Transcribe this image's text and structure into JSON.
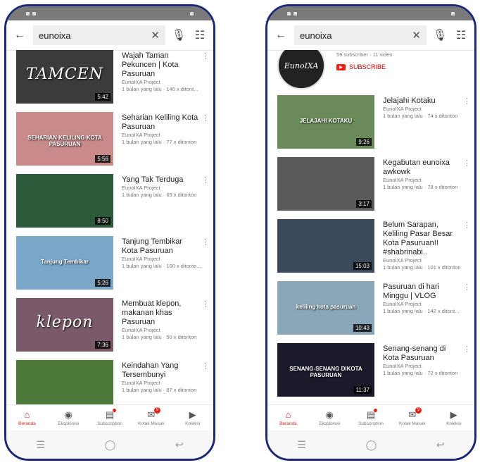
{
  "left": {
    "search": {
      "query": "eunoixa"
    },
    "videos": [
      {
        "title": "Wajah Taman Pekuncen | Kota Pasuruan",
        "channel": "EunoIXA Project",
        "stats": "1 bulan yang lalu · 140 x ditont...",
        "duration": "5:42",
        "caption": "TAMCEN"
      },
      {
        "title": "Seharian Keliling Kota Pasuruan",
        "channel": "EunoIXA Project",
        "stats": "1 bulan yang lalu · 77 x ditonton",
        "duration": "5:56",
        "caption": "SEHARIAN KELILING KOTA PASURUAN"
      },
      {
        "title": "Yang Tak Terduga",
        "channel": "EunoIXA Project",
        "stats": "1 bulan yang lalu · 65 x ditonton",
        "duration": "8:50",
        "caption": ""
      },
      {
        "title": "Tanjung Tembikar Kota Pasuruan",
        "channel": "EunoIXA Project",
        "stats": "1 bulan yang lalu · 100 x ditonto...",
        "duration": "5:26",
        "caption": "Tanjung Tembikar"
      },
      {
        "title": "Membuat klepon, makanan khas Pasuruan",
        "channel": "EunoIXA Project",
        "stats": "1 bulan yang lalu · 50 x ditonton",
        "duration": "7:36",
        "caption": "klepon"
      },
      {
        "title": "Keindahan Yang Tersembunyi",
        "channel": "EunoIXA Project",
        "stats": "1 bulan yang lalu · 87 x ditonton",
        "duration": "",
        "caption": ""
      }
    ]
  },
  "right": {
    "search": {
      "query": "eunoixa"
    },
    "channel": {
      "avatar_text": "EunoIXA",
      "subs": "59 subscriber · 11 video",
      "subscribe_label": "SUBSCRIBE"
    },
    "videos": [
      {
        "title": "Jelajahi Kotaku",
        "channel": "EunoIXA Project",
        "stats": "1 bulan yang lalu · 74 x ditonton",
        "duration": "9:26",
        "caption": "JELAJAHI KOTAKU"
      },
      {
        "title": "Kegabutan eunoixa awkowk",
        "channel": "EunoIXA Project",
        "stats": "1 bulan yang lalu · 78 x ditonton",
        "duration": "3:17",
        "caption": ""
      },
      {
        "title": "Belum Sarapan, Keliling Pasar Besar Kota Pasuruan!! #shabrinabi..",
        "channel": "EunoIXA Project",
        "stats": "1 bulan yang lalu · 101 x ditonton",
        "duration": "15:03",
        "caption": ""
      },
      {
        "title": "Pasuruan di hari Minggu | VLOG",
        "channel": "EunoIXA Project",
        "stats": "1 bulan yang lalu · 142 x ditont...",
        "duration": "10:43",
        "caption": "keliling kota pasuruan"
      },
      {
        "title": "Senang-senang di Kota Pasuruan",
        "channel": "EunoIXA Project",
        "stats": "1 bulan yang lalu · 72 x ditonton",
        "duration": "11:37",
        "caption": "SENANG-SENANG DIKOTA PASURUAN"
      }
    ]
  },
  "nav": [
    {
      "label": "Beranda",
      "icon": "home-icon",
      "glyph": "⌂"
    },
    {
      "label": "Eksplorasi",
      "icon": "explore-icon",
      "glyph": "◉"
    },
    {
      "label": "Subscription",
      "icon": "subscriptions-icon",
      "glyph": "▤"
    },
    {
      "label": "Kotak Masuk",
      "icon": "inbox-icon",
      "glyph": "✉",
      "badge": "9"
    },
    {
      "label": "Koleksi",
      "icon": "library-icon",
      "glyph": "▶"
    }
  ],
  "thumb_colors": {
    "left": [
      "#3b3b3b",
      "#c98a8a",
      "#2d5a3a",
      "#7aa7c7",
      "#7a5a6a",
      "#4d7a3a"
    ],
    "right": [
      "#6a8a5a",
      "#5a5a5a",
      "#3a4a5a",
      "#8aa7b7",
      "#1a1a2a"
    ]
  }
}
